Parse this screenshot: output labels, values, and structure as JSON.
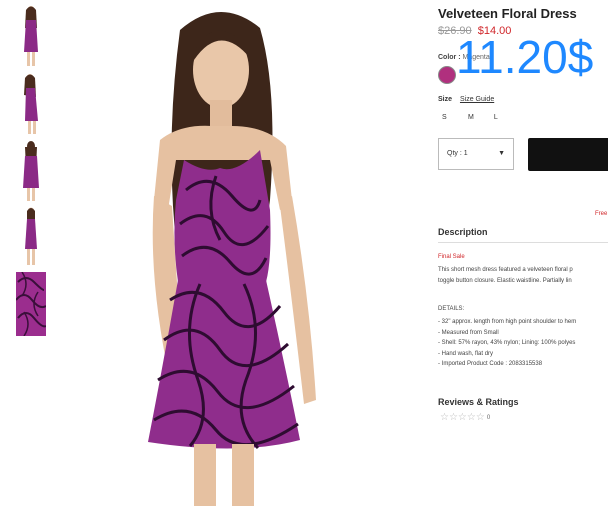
{
  "product": {
    "title": "Velveteen Floral Dress",
    "old_price": "$26.90",
    "sale_price": "$14.00",
    "overlay_price": "11.20$"
  },
  "color": {
    "label": "Color :",
    "value": "Magenta",
    "swatch_color": "#b0307e"
  },
  "size": {
    "label": "Size",
    "guide_label": "Size Guide",
    "options": [
      "S",
      "M",
      "L"
    ]
  },
  "quantity": {
    "label": "Qty : 1",
    "arrow": "▼"
  },
  "shipping_note": "Free",
  "description": {
    "title": "Description",
    "final_sale": "Final Sale",
    "lines": [
      "This short mesh dress featured a velveteen floral p",
      "toggle button closure. Elastic waistline. Partially lin"
    ],
    "details_title": "DETAILS:",
    "details": [
      "- 32\" approx. length from high point shoulder to hem",
      "- Measured from Small",
      "- Shell: 57% rayon, 43% nylon; Lining: 100% polyes",
      "- Hand wash, flat dry",
      "- Imported Product Code : 2083315538"
    ]
  },
  "reviews": {
    "title": "Reviews & Ratings",
    "stars": "☆☆☆☆☆",
    "count": "0"
  }
}
